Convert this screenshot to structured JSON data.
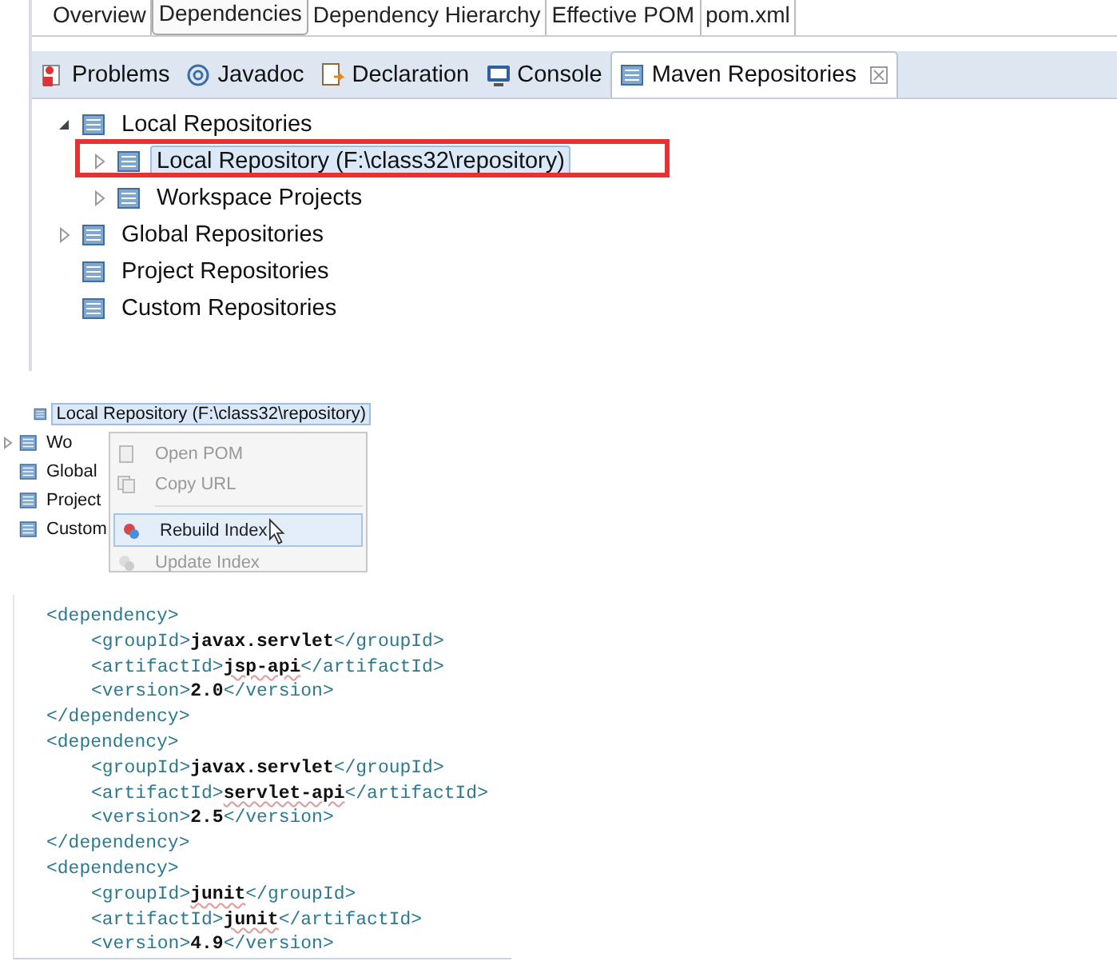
{
  "editor_tabs": [
    {
      "label": "Overview",
      "selected": false
    },
    {
      "label": "Dependencies",
      "selected": true
    },
    {
      "label": "Dependency Hierarchy",
      "selected": false
    },
    {
      "label": "Effective POM",
      "selected": false
    },
    {
      "label": "pom.xml",
      "selected": false
    }
  ],
  "view_tabs": [
    {
      "label": "Problems",
      "selected": false
    },
    {
      "label": "Javadoc",
      "selected": false
    },
    {
      "label": "Declaration",
      "selected": false
    },
    {
      "label": "Console",
      "selected": false
    },
    {
      "label": "Maven Repositories",
      "selected": true,
      "closable": true
    }
  ],
  "tree": [
    {
      "label": "Local Repositories",
      "kind": "folder",
      "expanded": true,
      "selected": false,
      "children": [
        {
          "label": "Local Repository (F:\\class32\\repository)",
          "kind": "folder",
          "expanded": false,
          "selected": true,
          "highlighted": true
        },
        {
          "label": "Workspace Projects",
          "kind": "folder",
          "expanded": false,
          "selected": false
        }
      ]
    },
    {
      "label": "Global Repositories",
      "kind": "folder",
      "expanded": false,
      "selected": false
    },
    {
      "label": "Project Repositories",
      "kind": "leaf",
      "selected": false
    },
    {
      "label": "Custom Repositories",
      "kind": "leaf",
      "selected": false
    }
  ],
  "context_tree": [
    {
      "label": "Local Repository (F:\\class32\\repository)",
      "kind": "child",
      "selected": true
    },
    {
      "label": "Wo",
      "kind": "folder",
      "expanded": false,
      "selected": false
    },
    {
      "label": "Global",
      "kind": "leaf",
      "selected": false
    },
    {
      "label": "Project",
      "kind": "leaf",
      "selected": false
    },
    {
      "label": "Custom",
      "kind": "leaf",
      "selected": false
    }
  ],
  "context_menu": [
    {
      "label": "Open POM",
      "kind": "item",
      "disabled": true,
      "selected": false
    },
    {
      "label": "Copy URL",
      "kind": "item",
      "disabled": true,
      "selected": false
    },
    {
      "kind": "separator"
    },
    {
      "label": "Rebuild Index",
      "kind": "item",
      "disabled": false,
      "selected": true
    },
    {
      "label": "Update Index",
      "kind": "item",
      "disabled": true,
      "selected": false
    }
  ],
  "code": [
    {
      "open": "<dependency>",
      "close": "</dependency>",
      "children": [
        {
          "open": "<groupId>",
          "value": "javax.servlet",
          "spell_error": false,
          "close": "</groupId>"
        },
        {
          "open": "<artifactId>",
          "value": "jsp-api",
          "spell_error": true,
          "close": "</artifactId>"
        },
        {
          "open": "<version>",
          "value": "2.0",
          "spell_error": false,
          "close": "</version>"
        }
      ]
    },
    {
      "open": "<dependency>",
      "close": "</dependency>",
      "children": [
        {
          "open": "<groupId>",
          "value": "javax.servlet",
          "spell_error": false,
          "close": "</groupId>"
        },
        {
          "open": "<artifactId>",
          "value": "servlet-api",
          "spell_error": true,
          "close": "</artifactId>"
        },
        {
          "open": "<version>",
          "value": "2.5",
          "spell_error": false,
          "close": "</version>"
        }
      ]
    },
    {
      "open": "<dependency>",
      "children": [
        {
          "open": "<groupId>",
          "value": "junit",
          "spell_error": true,
          "close": "</groupId>"
        },
        {
          "open": "<artifactId>",
          "value": "junit",
          "spell_error": true,
          "close": "</artifactId>"
        },
        {
          "open": "<version>",
          "value": "4.9",
          "spell_error": false,
          "close": "</version>"
        }
      ]
    }
  ]
}
